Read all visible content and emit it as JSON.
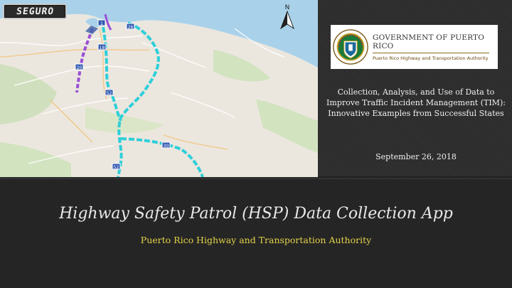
{
  "map": {
    "logo_text": "SEGURO",
    "compass_label": "N",
    "road_markers": [
      "1",
      "26",
      "18",
      "20",
      "52",
      "30",
      "52"
    ],
    "colors": {
      "route_highlight": "#2ecfd8",
      "route_alt": "#9b4fd6"
    }
  },
  "government_logo": {
    "title": "GOVERNMENT OF PUERTO RICO",
    "subtitle": "Puerto Rico Highway and Transportation Authority"
  },
  "event": {
    "description": "Collection, Analysis, and Use of Data to Improve Traffic Incident Management (TIM): Innovative Examples from Successful States",
    "date": "September 26, 2018"
  },
  "title": "Highway Safety Patrol (HSP) Data Collection App",
  "subtitle": "Puerto Rico Highway and Transportation Authority",
  "theme_colors": {
    "background": "#242424",
    "subtitle": "#e2d24a",
    "title": "#e8e8e8"
  }
}
